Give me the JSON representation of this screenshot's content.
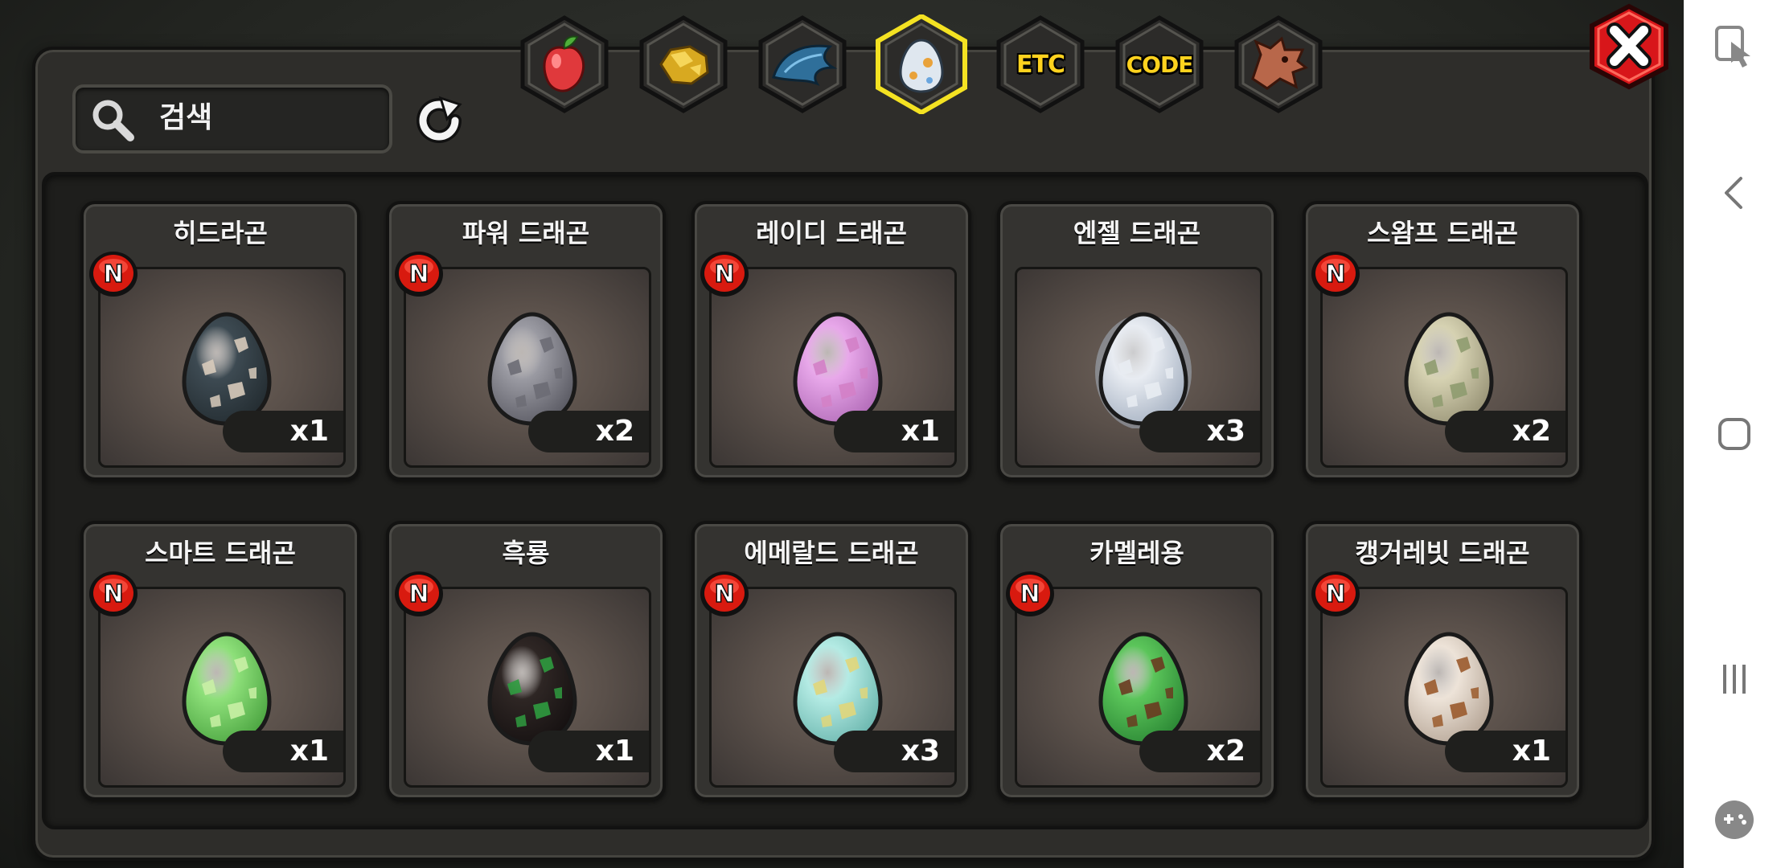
{
  "search": {
    "placeholder": "검색"
  },
  "tabs": [
    {
      "id": "fruit",
      "label": "",
      "icon": "fruit-icon",
      "selected": false
    },
    {
      "id": "gold",
      "label": "",
      "icon": "gold-nugget-icon",
      "selected": false
    },
    {
      "id": "wing",
      "label": "",
      "icon": "dragon-wing-icon",
      "selected": false
    },
    {
      "id": "egg",
      "label": "",
      "icon": "egg-icon",
      "selected": true
    },
    {
      "id": "etc",
      "label": "ETC",
      "icon": "",
      "selected": false
    },
    {
      "id": "code",
      "label": "CODE",
      "icon": "",
      "selected": false
    },
    {
      "id": "dragon",
      "label": "",
      "icon": "dragon-head-icon",
      "selected": false
    }
  ],
  "items": [
    {
      "name": "히드라곤",
      "count": "x1",
      "new": "N",
      "egg": {
        "base": "#3d4a52",
        "dark": "#252e33",
        "spot": "#d8cbbb"
      }
    },
    {
      "name": "파워 드래곤",
      "count": "x2",
      "new": "N",
      "egg": {
        "base": "#9a9aa2",
        "dark": "#5d5d66",
        "spot": "#6c6c74"
      }
    },
    {
      "name": "레이디 드래곤",
      "count": "x1",
      "new": "N",
      "egg": {
        "base": "#e8a8ea",
        "dark": "#b56fbb",
        "spot": "#d380c6"
      }
    },
    {
      "name": "엔젤 드래곤",
      "count": "x3",
      "new": "",
      "egg": {
        "base": "#e8ecf2",
        "dark": "#a9b4c4",
        "spot": "#e8ecf2"
      }
    },
    {
      "name": "스왐프 드래곤",
      "count": "x2",
      "new": "N",
      "egg": {
        "base": "#d6d2b2",
        "dark": "#9c977a",
        "spot": "#8e9b6f"
      }
    },
    {
      "name": "스마트 드래곤",
      "count": "x1",
      "new": "N",
      "egg": {
        "base": "#8ee07a",
        "dark": "#4fa844",
        "spot": "#c9f0a5"
      }
    },
    {
      "name": "흑룡",
      "count": "x1",
      "new": "N",
      "egg": {
        "base": "#2e2624",
        "dark": "#171212",
        "spot": "#2f9b3f"
      }
    },
    {
      "name": "에메랄드 드래곤",
      "count": "x3",
      "new": "N",
      "egg": {
        "base": "#b4ebe4",
        "dark": "#6fb9b1",
        "spot": "#e1d67a"
      }
    },
    {
      "name": "카멜레용",
      "count": "x2",
      "new": "N",
      "egg": {
        "base": "#5bc55a",
        "dark": "#2d8a36",
        "spot": "#6a3a20"
      }
    },
    {
      "name": "캥거레빗 드래곤",
      "count": "x1",
      "new": "N",
      "egg": {
        "base": "#ede3d8",
        "dark": "#b9a99a",
        "spot": "#9a5a2c"
      }
    }
  ],
  "nav": {
    "icons": [
      "screen-touch-icon",
      "back-icon",
      "home-icon",
      "recents-icon",
      "game-tools-icon"
    ]
  },
  "colors": {
    "tab_selected": "#f4e222",
    "badge_red": "#d81a0f",
    "close_red": "#d8161a"
  }
}
